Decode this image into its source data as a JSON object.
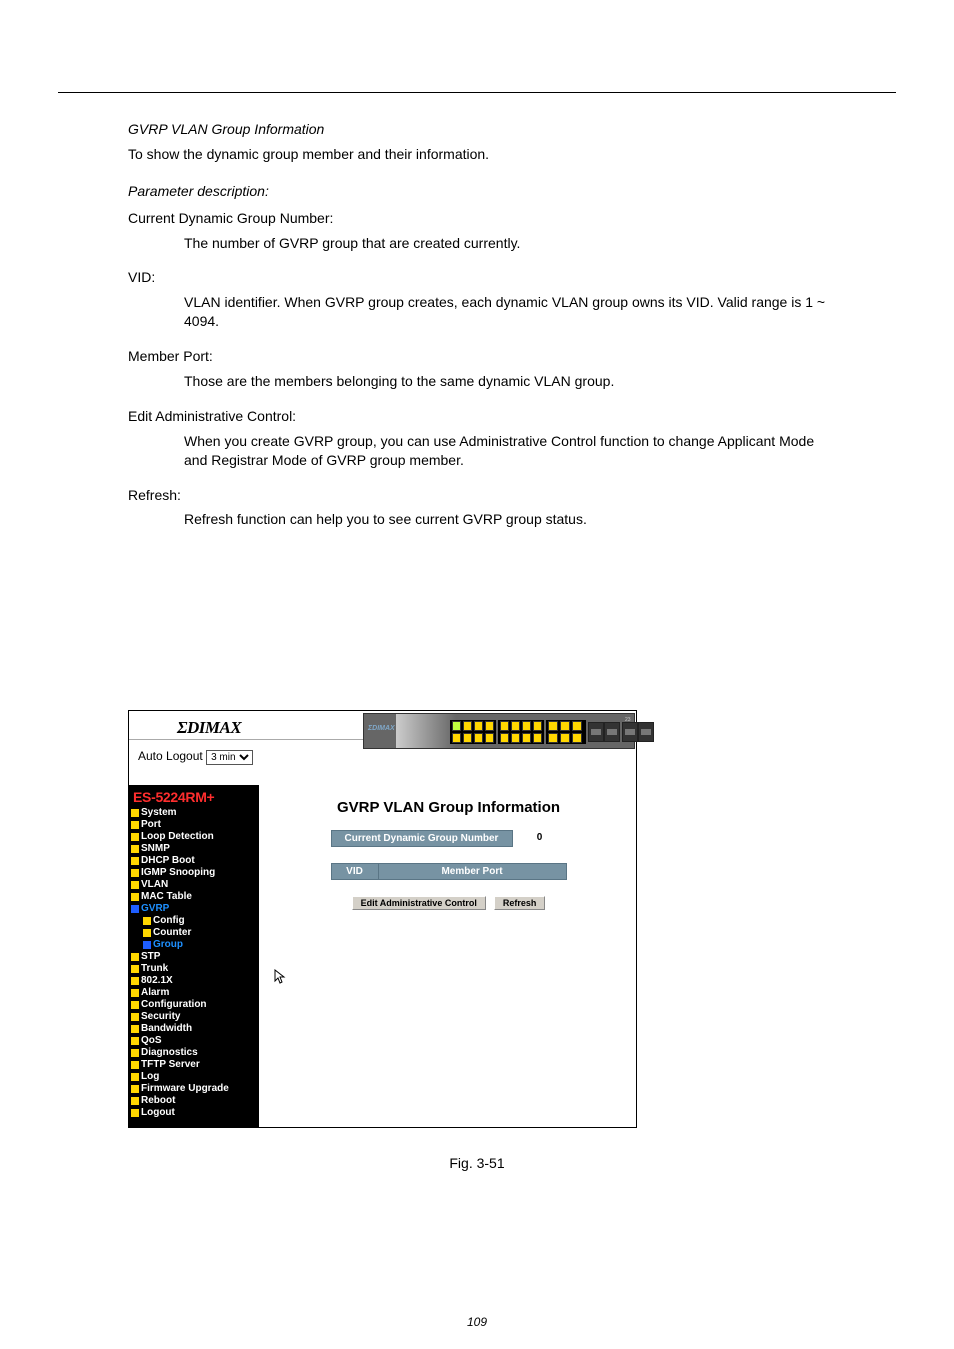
{
  "page": {
    "number": "109"
  },
  "body": {
    "heading": "GVRP VLAN Group Information",
    "para1": "To show the dynamic group member and their information.",
    "paramLabel": "Parameter description:",
    "p_groupNum_t": "Current Dynamic Group Number:",
    "p_groupNum_d": "The number of GVRP group that are created currently.",
    "p_vid_t": "VID:",
    "p_vid_d": "VLAN identifier. When GVRP group creates, each dynamic VLAN group owns its VID. Valid range is 1 ~ 4094.",
    "p_member_t": "Member Port:",
    "p_member_d": "Those are the members belonging to the same dynamic VLAN group.",
    "p_edit_t": "Edit Administrative Control:",
    "p_edit_d": "When you create GVRP group, you can use Administrative Control function to change Applicant Mode and Registrar Mode of GVRP group member.",
    "p_refresh_t": "Refresh:",
    "p_refresh_d": "Refresh function can help you to see current GVRP group status."
  },
  "caption": "Fig. 3-51",
  "ss": {
    "logo": "ΣDIMAX",
    "autoLogoutLabel": "Auto Logout",
    "autoLogoutValue": "3 min",
    "deviceTitle": "ES-5224RM+",
    "menu": {
      "system": "System",
      "port": "Port",
      "loop": "Loop Detection",
      "snmp": "SNMP",
      "dhcp": "DHCP Boot",
      "igmp": "IGMP Snooping",
      "vlan": "VLAN",
      "mactable": "MAC Table",
      "gvrp": "GVRP",
      "config": "Config",
      "counter": "Counter",
      "group": "Group",
      "stp": "STP",
      "trunk": "Trunk",
      "dot1x": "802.1X",
      "alarm": "Alarm",
      "configuration": "Configuration",
      "security": "Security",
      "bandwidth": "Bandwidth",
      "qos": "QoS",
      "diagnostics": "Diagnostics",
      "tftp": "TFTP Server",
      "log": "Log",
      "firmware": "Firmware Upgrade",
      "reboot": "Reboot",
      "logout": "Logout"
    },
    "content": {
      "title": "GVRP VLAN Group Information",
      "groupNumLabel": "Current Dynamic Group Number",
      "groupNumValue": "0",
      "colVid": "VID",
      "colMember": "Member Port",
      "btnEdit": "Edit Administrative Control",
      "btnRefresh": "Refresh"
    }
  }
}
